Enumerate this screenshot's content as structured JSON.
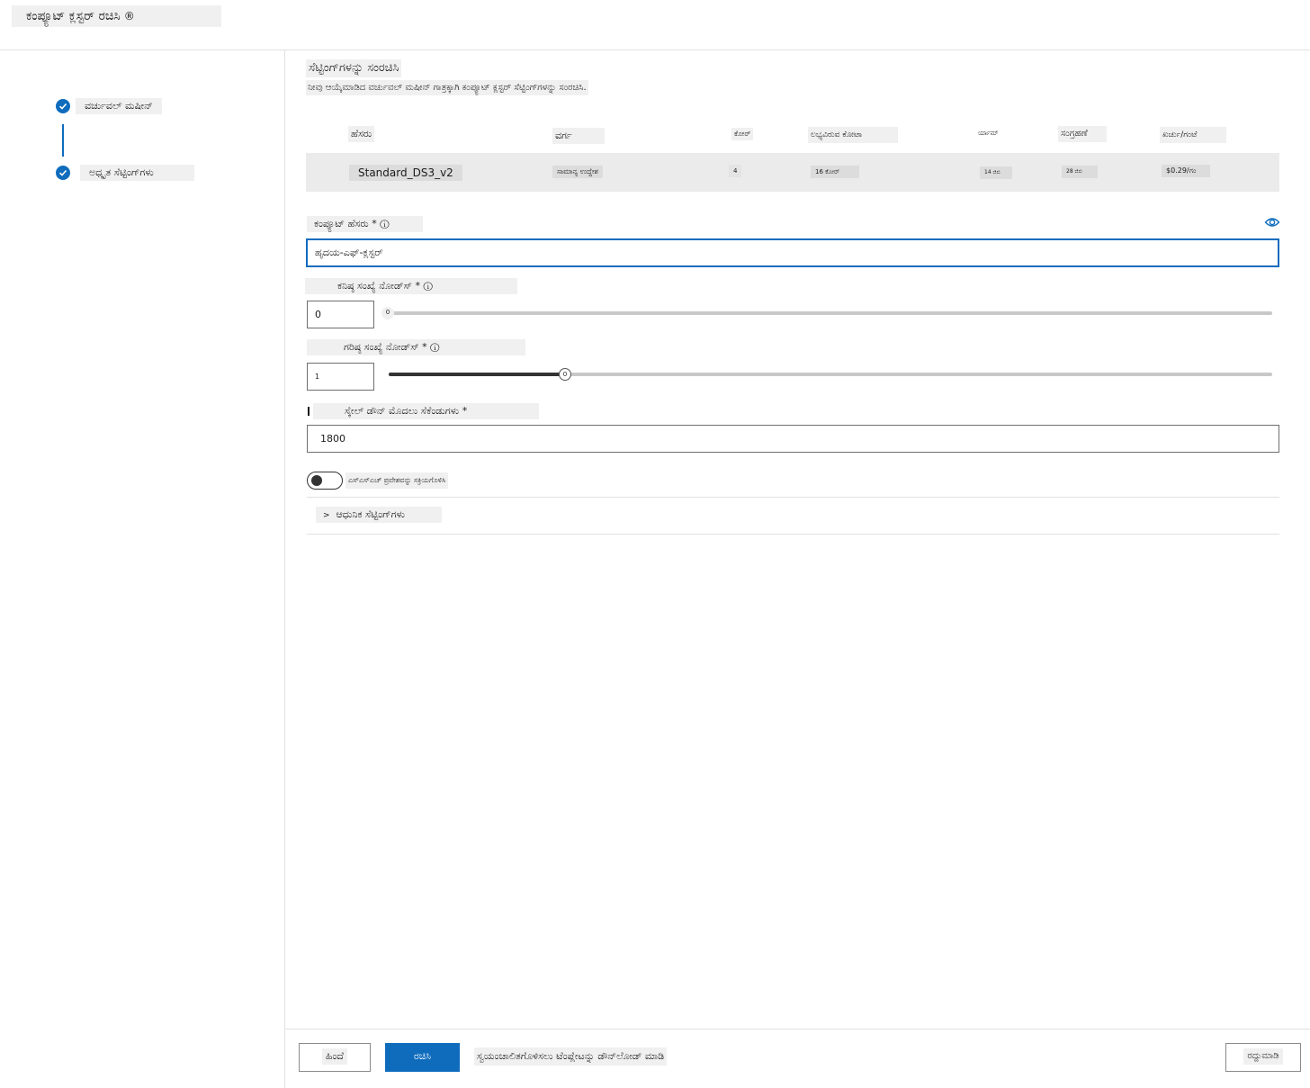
{
  "header": {
    "title": "ಕಂಪ್ಯೂಟ್ ಕ್ಲಸ್ಟರ್ ರಚಿಸಿ",
    "info_icon": "info-icon"
  },
  "steps": [
    {
      "label": "ವರ್ಚುವಲ್ ಮಷೀನ್",
      "icon": "checkmark-icon",
      "status": "complete"
    },
    {
      "label": "ಅಧ್ಕೃತ ಸೆಟ್ಟಿಂಗ್‌ಗಳು",
      "icon": "checkmark-icon",
      "status": "complete"
    }
  ],
  "main": {
    "title": "ಸೆಟ್ಟಿಂಗ್‌ಗಳನ್ನು ಸಂರಚಿಸಿ",
    "description": "ನೀವು ಆಯ್ಕೆಮಾಡಿದ ವರ್ಚುವಲ್ ಮಷೀನ್ ಗಾತ್ರಕ್ಕಾಗಿ ಕಂಪ್ಯೂಟ್ ಕ್ಲಸ್ಟರ್ ಸೆಟ್ಟಿಂಗ್‌ಗಳನ್ನು ಸಂರಚಿಸಿ."
  },
  "vm_table": {
    "headers": [
      "ಹೆಸರು",
      "ವರ್ಗ",
      "ಕೋರ್",
      "ಲಭ್ಯವಿರುವ ಕೋಟಾ",
      "ರ್ಯಾಮ್",
      "ಸಂಗ್ರಹಣೆ",
      "ಖರ್ಚು/ಗಂಟೆ"
    ],
    "row": [
      "Standard_DS3_v2",
      "ಸಾಮಾನ್ಯ ಉದ್ದೇಶ",
      "4",
      "16 ಕೋರ್",
      "14 ಜಿಬಿ",
      "28 ಜಿಬಿ",
      "$0.29/ಗಂ"
    ]
  },
  "compute_name": {
    "label": "ಕಂಪ್ಯೂಟ್ ಹೆಸರು",
    "required": "*",
    "info": "ⓘ",
    "value": "ಹೃದಯ-ಎಫ್-ಕ್ಲಸ್ಟರ್",
    "icon": "eye-icon"
  },
  "min_nodes": {
    "label": "ಕನಿಷ್ಠ ಸಂಖ್ಯೆ ನೋಡ್‌ಸ್",
    "required": "*",
    "info": "ⓘ",
    "value": "0",
    "thumb_label": "0",
    "slider_fraction": 0
  },
  "max_nodes": {
    "label": "ಗರಿಷ್ಠ ಸಂಖ್ಯೆ ನೋಡ್‌ಸ್",
    "required": "*",
    "info": "ⓘ",
    "value": "1",
    "thumb_label": "0",
    "slider_fraction": 0.2
  },
  "idle_seconds": {
    "label": "ಸ್ಕೇಲ್ ಡೌನ್ ಮೊದಲು ಸೆಕೆಂಡುಗಳು",
    "required": "*",
    "value": "1800"
  },
  "ssh_toggle": {
    "label": "ಎಸ್‌ಎಸ್‌ಎಚ್ ಪ್ರವೇಶವನ್ನು ಸಕ್ರಿಯಗೊಳಿಸಿ",
    "on": false
  },
  "advanced": {
    "chevron": "chevron-right-icon",
    "label": "ಆಧುನಿಕ ಸೆಟ್ಟಿಂಗ್‌ಗಳು"
  },
  "footer": {
    "back_label": "ಹಿಂದೆ",
    "create_label": "ರಚಿಸಿ",
    "download_link": "ಸ್ವಯಂಚಾಲಿತಗೊಳಿಸಲು ಟೆಂಪ್ಲೇಟನ್ನು ಡೌನ್‌ಲೋಡ್ ಮಾಡಿ",
    "cancel_label": "ರದ್ದುಮಾಡಿ"
  },
  "colors": {
    "accent": "#0f6cbd"
  }
}
